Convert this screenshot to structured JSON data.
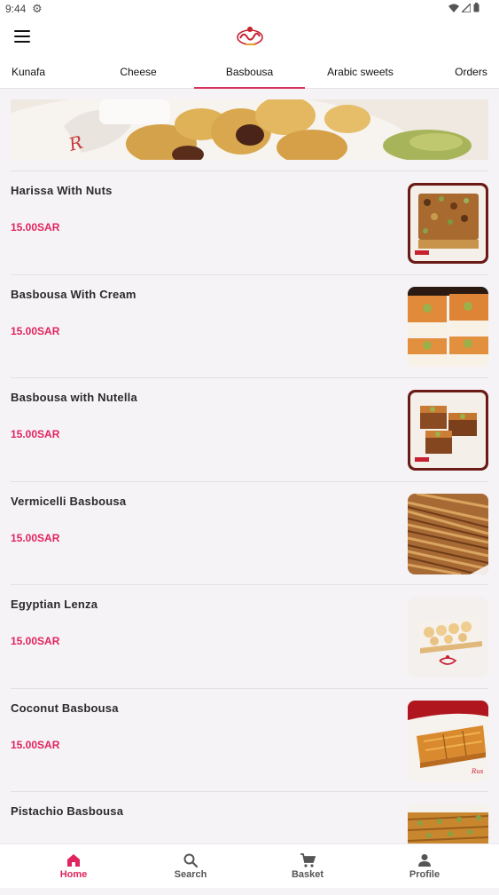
{
  "status_bar": {
    "time": "9:44"
  },
  "tabs": [
    {
      "label": "Kunafa"
    },
    {
      "label": "Cheese"
    },
    {
      "label": "Basbousa",
      "active": true
    },
    {
      "label": "Arabic sweets"
    },
    {
      "label": "Orders"
    }
  ],
  "products": [
    {
      "name": "Harissa With Nuts",
      "price": "15.00SAR"
    },
    {
      "name": "Basbousa With Cream",
      "price": "15.00SAR"
    },
    {
      "name": "Basbousa with Nutella",
      "price": "15.00SAR"
    },
    {
      "name": "Vermicelli Basbousa",
      "price": "15.00SAR"
    },
    {
      "name": "Egyptian Lenza",
      "price": "15.00SAR"
    },
    {
      "name": "Coconut Basbousa",
      "price": "15.00SAR"
    },
    {
      "name": "Pistachio Basbousa",
      "price": ""
    }
  ],
  "bottom_nav": [
    {
      "label": "Home",
      "icon": "home-icon",
      "active": true
    },
    {
      "label": "Search",
      "icon": "search-icon"
    },
    {
      "label": "Basket",
      "icon": "basket-icon"
    },
    {
      "label": "Profile",
      "icon": "profile-icon"
    }
  ],
  "colors": {
    "accent": "#e0245e",
    "tab_indicator": "#d6335e"
  }
}
